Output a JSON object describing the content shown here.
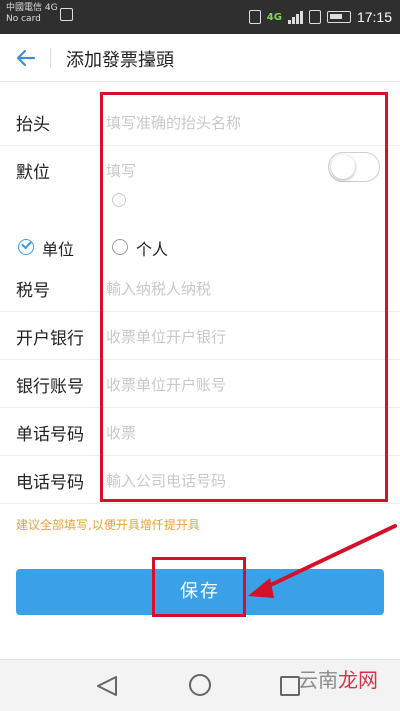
{
  "status_bar": {
    "carrier": "中國電信 4G",
    "sim": "No card",
    "network": "4G",
    "time": "17:15"
  },
  "header": {
    "title": "添加發票擡頭"
  },
  "form": {
    "title_row": {
      "label": "抬头",
      "placeholder": "填写准确的抬头名称"
    },
    "unit_row": {
      "label": "默位",
      "placeholder": "填写"
    },
    "type": {
      "options": [
        {
          "label": "单位",
          "checked": true
        },
        {
          "label": "个人",
          "checked": false
        }
      ]
    },
    "tax_row": {
      "label": "税号",
      "placeholder": "輸入纳税人纳税"
    },
    "bank_row": {
      "label": "开户银行",
      "placeholder": "收票单位开户银行"
    },
    "account_row": {
      "label": "银行账号",
      "placeholder": "收票单位开户账号"
    },
    "address_row": {
      "label": "单话号码",
      "placeholder": "收票"
    },
    "phone_row": {
      "label": "电话号码",
      "placeholder": "輸入公司电话号码"
    }
  },
  "hint": "建议全部填写,以便开具增仟提开具",
  "save_button": "保存",
  "watermark": {
    "part1": "云南",
    "part2": "龙网"
  },
  "colors": {
    "accent": "#3aa0e8",
    "annotation": "#d3112a",
    "hint": "#e8a33a"
  }
}
